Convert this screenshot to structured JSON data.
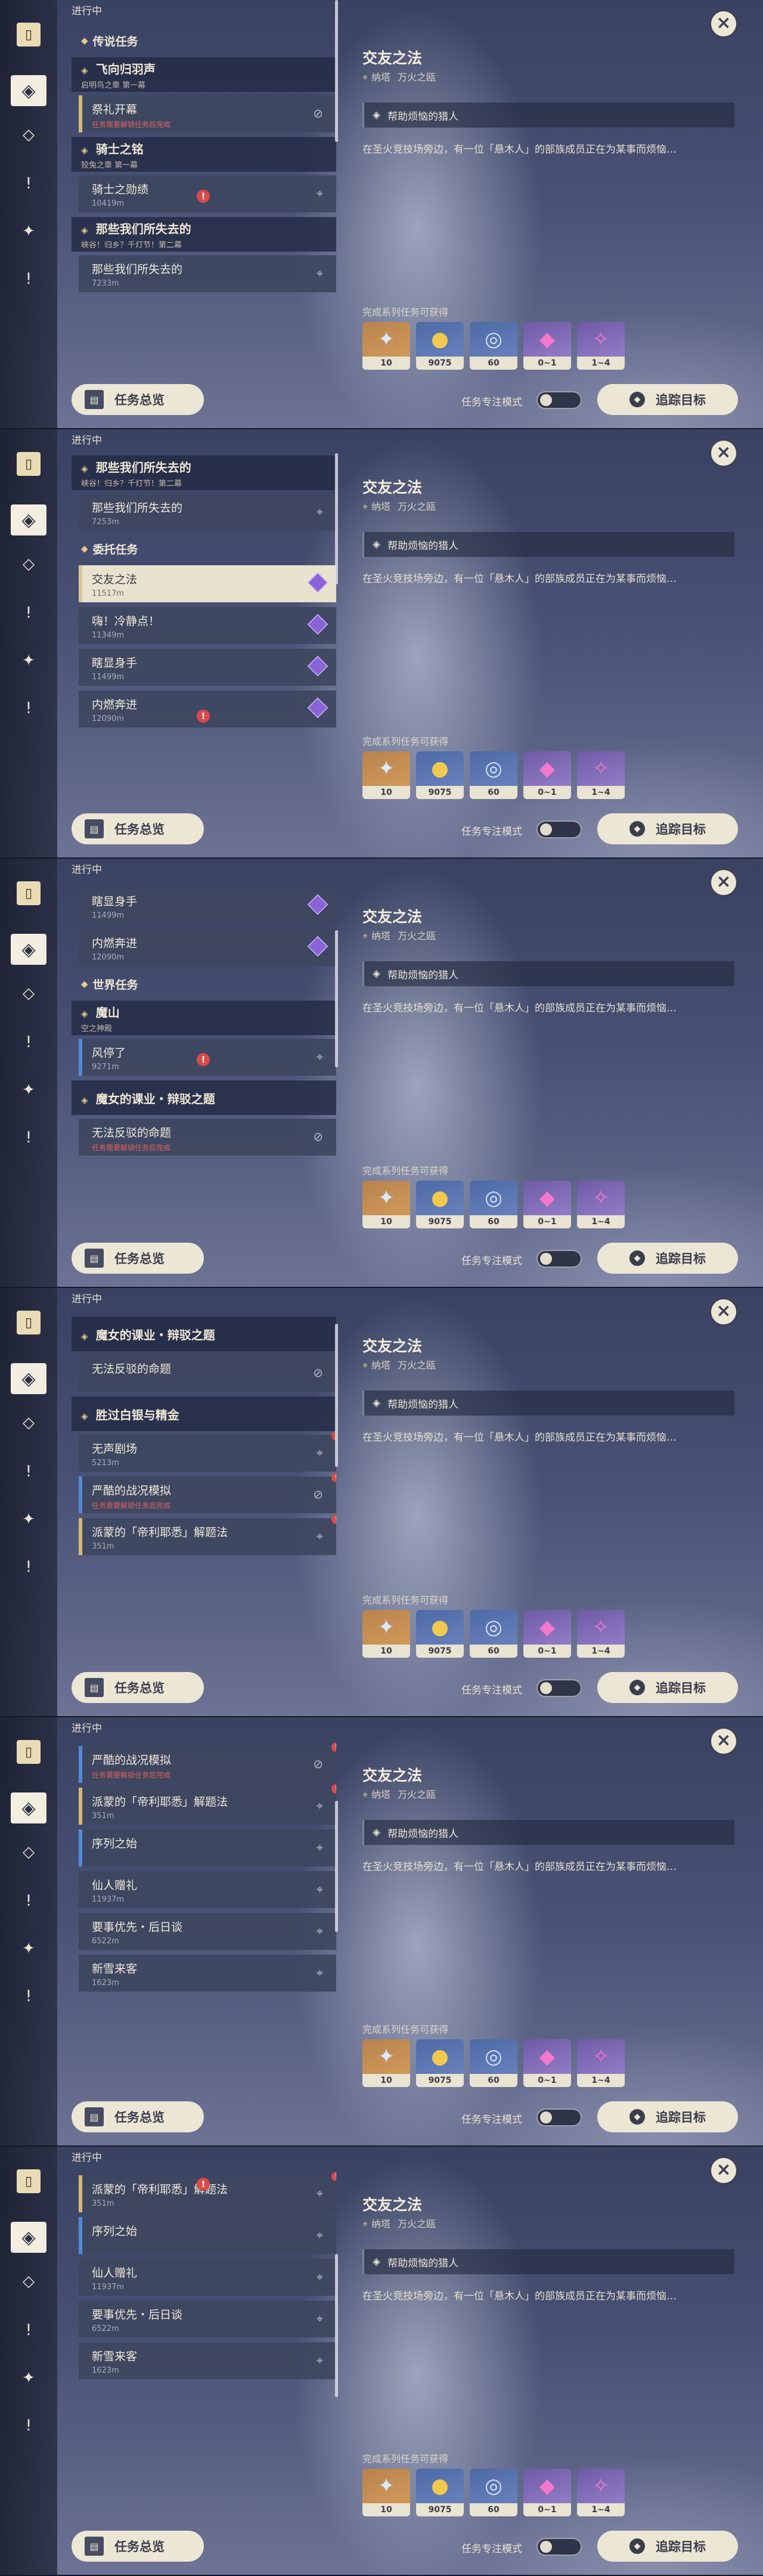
{
  "ui": {
    "in_progress": "进行中",
    "overview_button": "任务总览",
    "focus_mode_label": "任务专注模式",
    "track_button": "追踪目标",
    "rewards_label": "完成系列任务可获得",
    "close_label": "×"
  },
  "detail": {
    "title": "交友之法",
    "location_region": "纳塔",
    "location_area": "万火之瓯",
    "objective": "帮助烦恼的猎人",
    "description": "在圣火竞技场旁边，有一位「悬木人」的部族成员正在为某事而烦恼…",
    "rewards": [
      {
        "icon": "adventure-exp-icon",
        "count": "10"
      },
      {
        "icon": "mora-coin-icon",
        "count": "9075"
      },
      {
        "icon": "hero-wit-icon",
        "count": "60"
      },
      {
        "icon": "crystal-fragment-icon",
        "count": "0~1"
      },
      {
        "icon": "crystal-chunk-icon",
        "count": "1~4"
      }
    ]
  },
  "panels": [
    {
      "items": [
        {
          "type": "section",
          "label": "传说任务"
        },
        {
          "type": "group",
          "label": "飞向归羽声",
          "sub": "启明鸟之章 第一幕"
        },
        {
          "type": "quest",
          "name": "祭礼开幕",
          "warn": "任务需要解锁任务后完成",
          "icon": "blocked-icon",
          "bar": "gold"
        },
        {
          "type": "group",
          "label": "骑士之铭",
          "sub": "狡兔之章 第一幕"
        },
        {
          "type": "quest",
          "name": "骑士之勋绩",
          "dist": "10419m",
          "icon": "pin-icon"
        },
        {
          "type": "group",
          "label": "那些我们所失去的",
          "sub": "峡谷！归乡？千灯节！第二幕"
        },
        {
          "type": "quest",
          "name": "那些我们所失去的",
          "dist": "7233m",
          "icon": "pin-icon"
        }
      ]
    },
    {
      "items": [
        {
          "type": "group",
          "label": "那些我们所失去的",
          "sub": "峡谷！归乡？千灯节！第二幕"
        },
        {
          "type": "quest",
          "name": "那些我们所失去的",
          "dist": "7253m",
          "icon": "pin-icon"
        },
        {
          "type": "section",
          "label": "委托任务"
        },
        {
          "type": "quest",
          "name": "交友之法",
          "dist": "11517m",
          "icon": "commission-icon",
          "selected": true
        },
        {
          "type": "quest",
          "name": "嗨！冷静点！",
          "dist": "11349m",
          "icon": "commission-icon"
        },
        {
          "type": "quest",
          "name": "瞎显身手",
          "dist": "11499m",
          "icon": "commission-icon"
        },
        {
          "type": "quest",
          "name": "内燃奔进",
          "dist": "12090m",
          "icon": "commission-icon"
        }
      ]
    },
    {
      "items": [
        {
          "type": "quest",
          "name": "瞎显身手",
          "dist": "11499m",
          "icon": "commission-icon"
        },
        {
          "type": "quest",
          "name": "内燃奔进",
          "dist": "12090m",
          "icon": "commission-icon"
        },
        {
          "type": "section",
          "label": "世界任务"
        },
        {
          "type": "group",
          "label": "魔山",
          "sub": "空之神殿"
        },
        {
          "type": "quest",
          "name": "风停了",
          "dist": "9271m",
          "icon": "pin-icon",
          "bar": "blue"
        },
        {
          "type": "group",
          "label": "魔女的课业・辩驳之题"
        },
        {
          "type": "quest",
          "name": "无法反驳的命题",
          "warn": "任务需要解锁任务后完成",
          "icon": "blocked-icon"
        }
      ]
    },
    {
      "items": [
        {
          "type": "group",
          "label": "魔女的课业・辩驳之题"
        },
        {
          "type": "quest",
          "name": "无法反驳的命题",
          "icon": "blocked-icon"
        },
        {
          "type": "group",
          "label": "胜过白银与精金"
        },
        {
          "type": "quest",
          "name": "无声剧场",
          "dist": "5213m",
          "icon": "pin-icon",
          "badge": "!"
        },
        {
          "type": "quest",
          "name": "严酷的战况模拟",
          "warn": "任务需要解锁任务后完成",
          "icon": "blocked-icon",
          "bar": "blue",
          "badge": "!"
        },
        {
          "type": "quest",
          "name": "派蒙的「帝利耶悉」解题法",
          "dist": "351m",
          "icon": "pin-icon",
          "bar": "gold",
          "badge": "!"
        }
      ]
    },
    {
      "items": [
        {
          "type": "quest",
          "name": "严酷的战况模拟",
          "warn": "任务需要解锁任务后完成",
          "icon": "blocked-icon",
          "bar": "blue",
          "badge": "!"
        },
        {
          "type": "quest",
          "name": "派蒙的「帝利耶悉」解题法",
          "dist": "351m",
          "icon": "pin-icon",
          "bar": "gold",
          "badge": "!"
        },
        {
          "type": "quest",
          "name": "序列之始",
          "icon": "pin-icon",
          "bar": "blue"
        },
        {
          "type": "quest",
          "name": "仙人赠礼",
          "dist": "11937m",
          "icon": "pin-icon"
        },
        {
          "type": "quest",
          "name": "要事优先・后日谈",
          "dist": "6522m",
          "icon": "pin-icon"
        },
        {
          "type": "quest",
          "name": "新雪来客",
          "dist": "1623m",
          "icon": "pin-icon"
        }
      ]
    },
    {
      "items": [
        {
          "type": "quest",
          "name": "派蒙的「帝利耶悉」解题法",
          "dist": "351m",
          "icon": "pin-icon",
          "bar": "gold",
          "badge": "!"
        },
        {
          "type": "quest",
          "name": "序列之始",
          "icon": "pin-icon",
          "bar": "blue"
        },
        {
          "type": "quest",
          "name": "仙人赠礼",
          "dist": "11937m",
          "icon": "pin-icon"
        },
        {
          "type": "quest",
          "name": "要事优先・后日谈",
          "dist": "6522m",
          "icon": "pin-icon"
        },
        {
          "type": "quest",
          "name": "新雪来客",
          "dist": "1623m",
          "icon": "pin-icon"
        }
      ]
    }
  ]
}
